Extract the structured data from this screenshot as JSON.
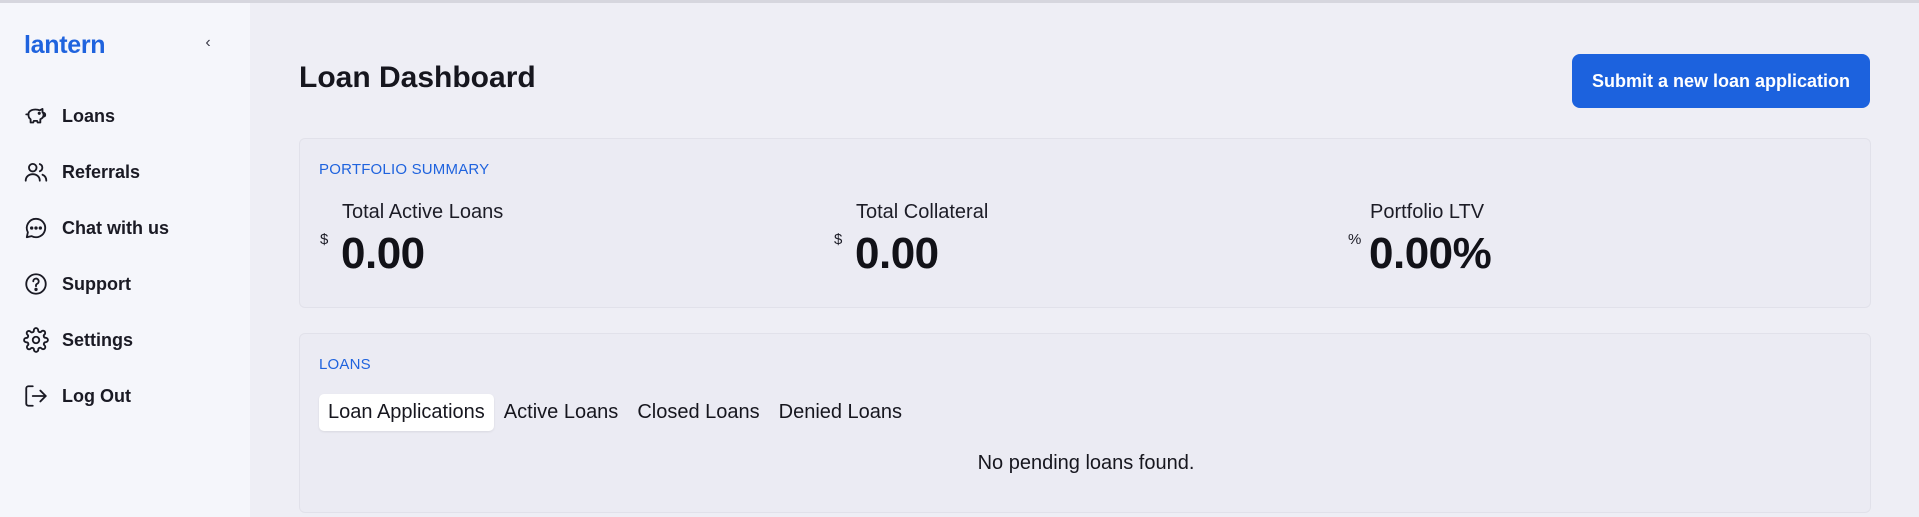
{
  "sidebar": {
    "logo": "lantern",
    "collapse_icon": "chevron-left-icon",
    "items": [
      {
        "label": "Loans",
        "icon": "piggy-bank-icon"
      },
      {
        "label": "Referrals",
        "icon": "users-icon"
      },
      {
        "label": "Chat with us",
        "icon": "chat-bubble-icon"
      },
      {
        "label": "Support",
        "icon": "help-circle-icon"
      },
      {
        "label": "Settings",
        "icon": "gear-icon"
      },
      {
        "label": "Log Out",
        "icon": "log-out-icon"
      }
    ]
  },
  "header": {
    "title": "Loan Dashboard",
    "primary_button": "Submit a new loan application"
  },
  "summary": {
    "section_label": "PORTFOLIO SUMMARY",
    "metrics": [
      {
        "label": "Total Active Loans",
        "unit": "$",
        "value": "0.00"
      },
      {
        "label": "Total Collateral",
        "unit": "$",
        "value": "0.00"
      },
      {
        "label": "Portfolio LTV",
        "unit": "%",
        "value": "0.00%"
      }
    ]
  },
  "loans": {
    "section_label": "LOANS",
    "tabs": [
      {
        "label": "Loan Applications",
        "active": true
      },
      {
        "label": "Active Loans",
        "active": false
      },
      {
        "label": "Closed Loans",
        "active": false
      },
      {
        "label": "Denied Loans",
        "active": false
      }
    ],
    "empty_message": "No pending loans found."
  },
  "colors": {
    "accent": "#1c62de",
    "background": "#eeeef5",
    "sidebar_bg": "#f5f6fb",
    "text": "#16161e"
  }
}
